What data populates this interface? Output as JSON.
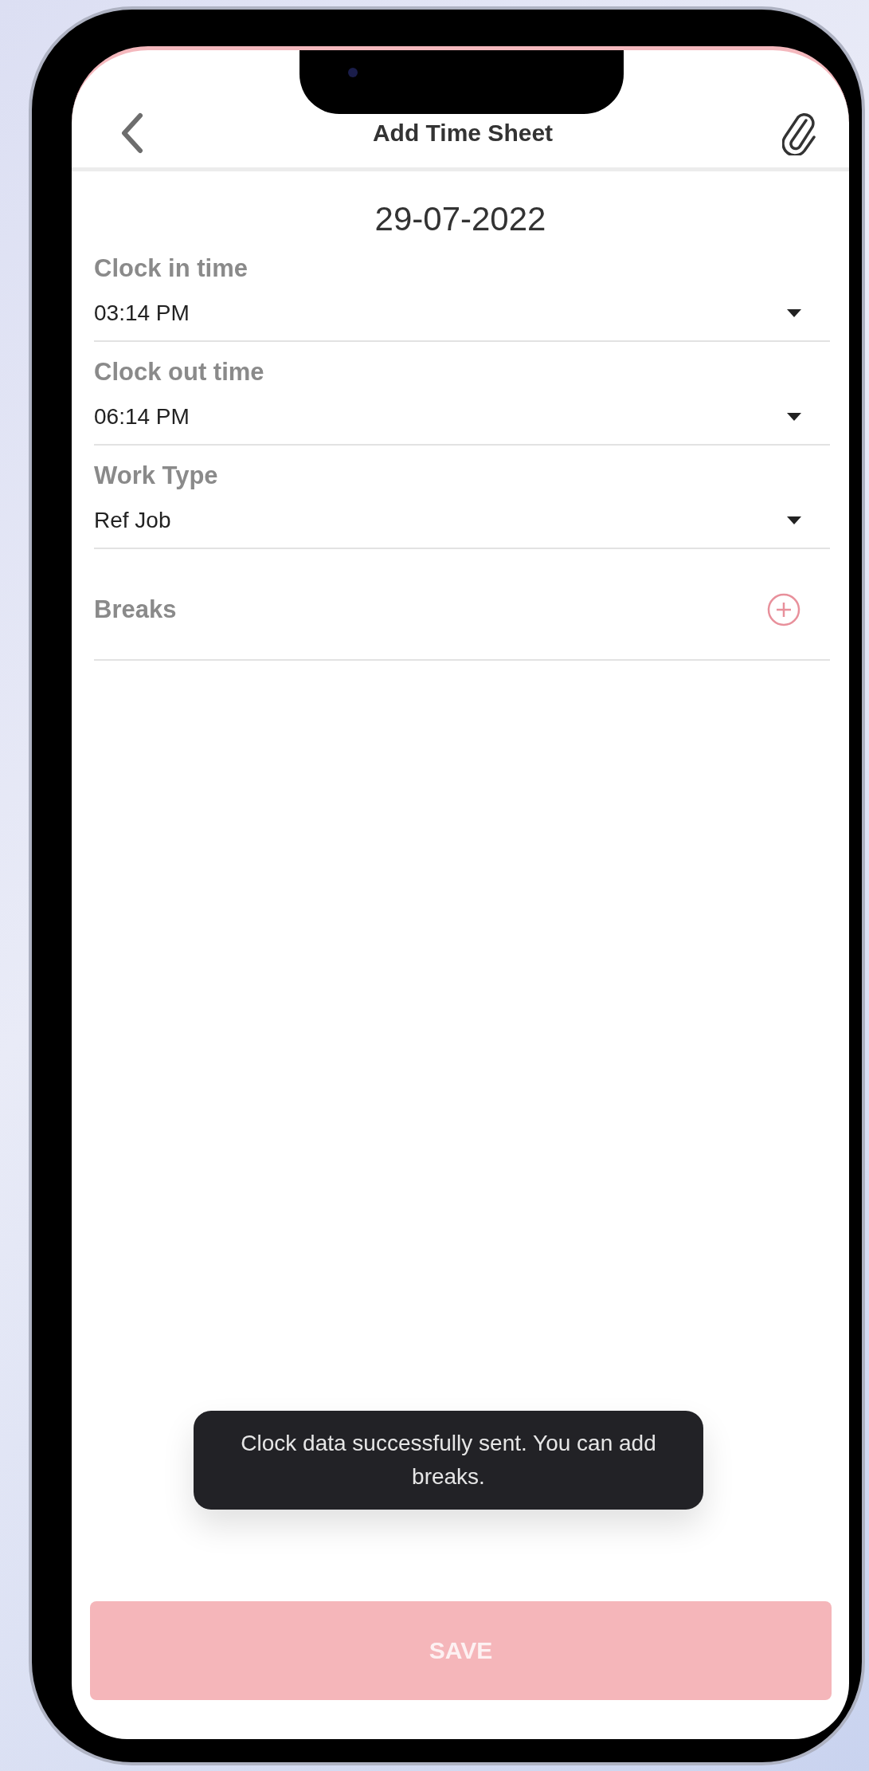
{
  "header": {
    "title": "Add Time Sheet"
  },
  "date": "29-07-2022",
  "fields": [
    {
      "kind": "dropdown",
      "label": "Clock in time",
      "value": "03:14 PM"
    },
    {
      "kind": "dropdown",
      "label": "Clock out time",
      "value": "06:14 PM"
    },
    {
      "kind": "dropdown",
      "label": "Work Type",
      "value": "Ref Job"
    },
    {
      "kind": "add",
      "label": "Breaks"
    }
  ],
  "toast": {
    "message": "Clock data successfully sent. You can add breaks."
  },
  "save_button": {
    "label": "SAVE",
    "disabled": true
  }
}
